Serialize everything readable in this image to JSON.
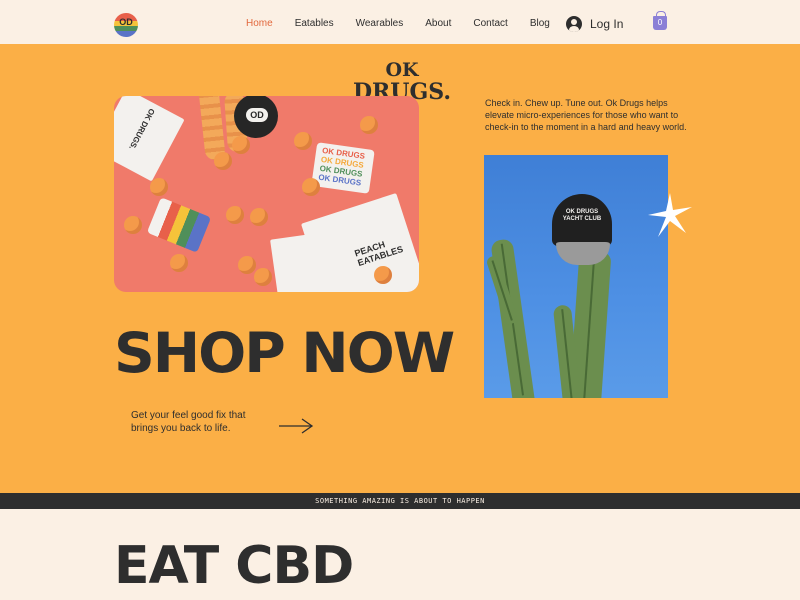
{
  "header": {
    "logo_text": "OD",
    "nav": [
      {
        "label": "Home",
        "active": true
      },
      {
        "label": "Eatables",
        "active": false
      },
      {
        "label": "Wearables",
        "active": false
      },
      {
        "label": "About",
        "active": false
      },
      {
        "label": "Contact",
        "active": false
      },
      {
        "label": "Blog",
        "active": false
      }
    ],
    "login_label": "Log In",
    "cart_count": "0"
  },
  "hero": {
    "brand_line1": "OK",
    "brand_line2": "DRUGS.",
    "tagline": "Check in. Chew up. Tune out. Ok Drugs helps elevate micro-experiences for those who want to check-in to the moment in a hard and heavy world.",
    "headline": "SHOP NOW",
    "subtext": "Get your feel good fix that brings you back to life."
  },
  "product_photo": {
    "badge": "OD",
    "sticker_lines": [
      "OK DRUGS",
      "OK DRUGS",
      "OK DRUGS",
      "OK DRUGS"
    ],
    "pouch_brand": "OK DRUGS.",
    "pouch_label": "PEACH EATABLES"
  },
  "cap_photo": {
    "cap_text": "OK DRUGS YACHT CLUB"
  },
  "ticker": {
    "text": "SOMETHING AMAZING IS ABOUT TO HAPPEN"
  },
  "section2": {
    "headline": "EAT CBD"
  },
  "colors": {
    "hero_bg": "#fbaf46",
    "page_bg": "#fbf0e4",
    "accent": "#e2683d",
    "dark": "#2e2e2e",
    "cart": "#8b7fd6"
  },
  "icons": {
    "user": "user-circle-icon",
    "cart": "shopping-bag-icon",
    "arrow": "arrow-right-icon",
    "spark": "sparkle-icon"
  }
}
